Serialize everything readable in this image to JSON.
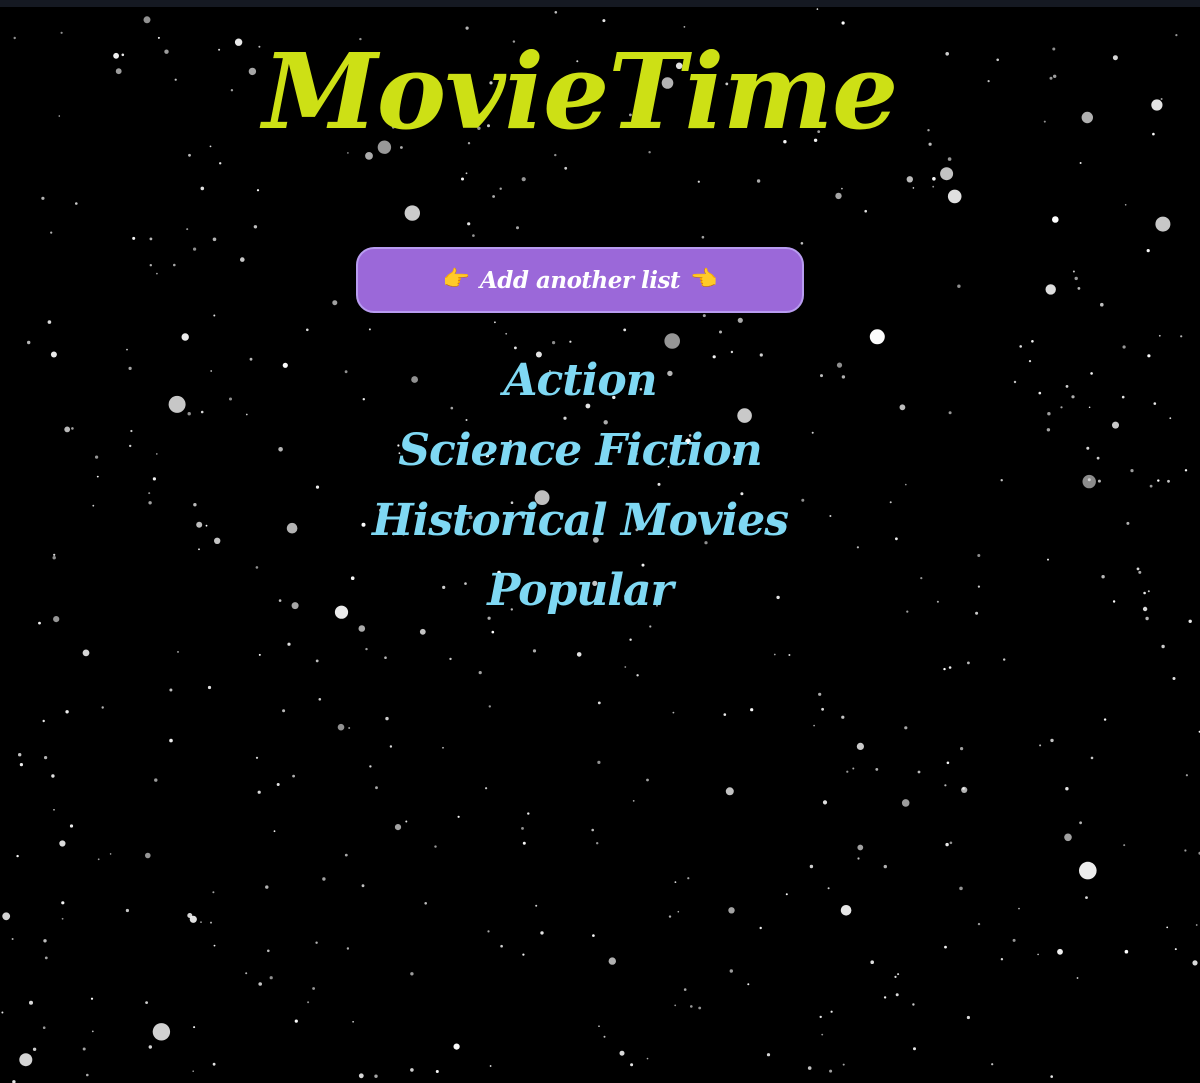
{
  "app": {
    "title": "MovieTime"
  },
  "toolbar": {
    "add_list_label": "Add another list",
    "left_icon": "pointing-right-hand-icon",
    "right_icon": "pointing-left-hand-icon",
    "left_glyph": "👉",
    "right_glyph": "👈"
  },
  "lists": [
    {
      "label": "Action"
    },
    {
      "label": "Science Fiction"
    },
    {
      "label": "Historical Movies"
    },
    {
      "label": "Popular"
    }
  ],
  "colors": {
    "background": "#000000",
    "title": "#cde015",
    "button_fill": "#9b68d9",
    "button_text": "#ffffff",
    "list_text": "#7fd8f3",
    "stars": "#ffffff"
  }
}
